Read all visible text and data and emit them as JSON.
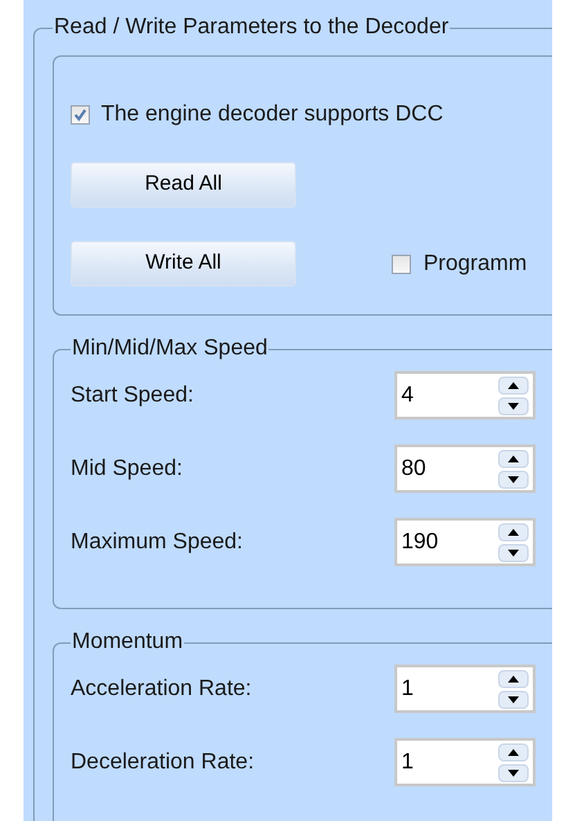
{
  "group": {
    "title": "Read / Write Parameters to the Decoder",
    "dcc_checkbox": {
      "label": "The engine decoder supports DCC",
      "checked": true
    },
    "buttons": [
      {
        "label": "Read All"
      },
      {
        "label": "Write All"
      }
    ],
    "program_checkbox": {
      "label": "Programm",
      "checked": false
    },
    "sections": [
      {
        "title": "Min/Mid/Max Speed",
        "fields": [
          {
            "label": "Start Speed:",
            "value": "4"
          },
          {
            "label": "Mid Speed:",
            "value": "80"
          },
          {
            "label": "Maximum Speed:",
            "value": "190"
          }
        ]
      },
      {
        "title": "Momentum",
        "fields": [
          {
            "label": "Acceleration Rate:",
            "value": "1"
          },
          {
            "label": "Deceleration Rate:",
            "value": "1"
          }
        ]
      }
    ]
  }
}
